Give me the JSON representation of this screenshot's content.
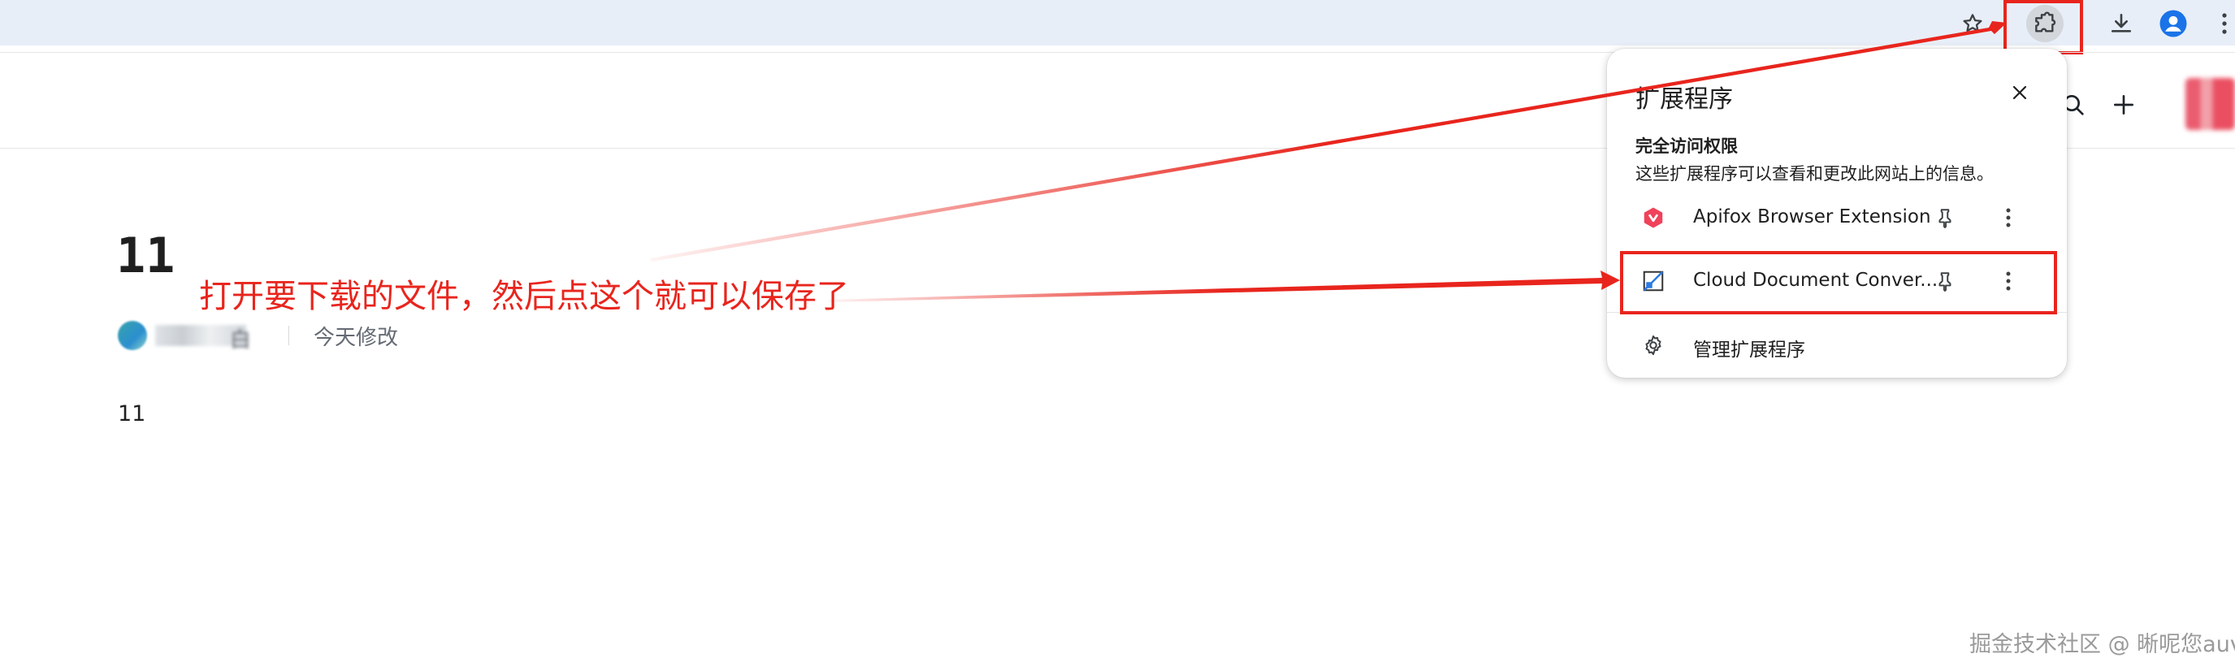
{
  "browser": {
    "toolbar_icons": [
      "star-icon",
      "puzzle-icon",
      "download-icon",
      "profile-icon",
      "more-vert-icon"
    ]
  },
  "document": {
    "title": "11",
    "author_suffix": "白",
    "modified": "今天修改",
    "body": "11"
  },
  "page_header_icons": [
    "search-icon",
    "plus-icon"
  ],
  "annotation": {
    "text": "打开要下载的文件，然后点这个就可以保存了",
    "color": "#e8251d"
  },
  "extensions_popup": {
    "title": "扩展程序",
    "section_title": "完全访问权限",
    "section_desc": "这些扩展程序可以查看和更改此网站上的信息。",
    "items": [
      {
        "name": "Apifox Browser Extension",
        "icon": "apifox-icon"
      },
      {
        "name": "Cloud Document Conver...",
        "icon": "cloud-document-converter-icon"
      }
    ],
    "manage_label": "管理扩展程序"
  },
  "watermark": "掘金技术社区 @ 晰呢您auv"
}
